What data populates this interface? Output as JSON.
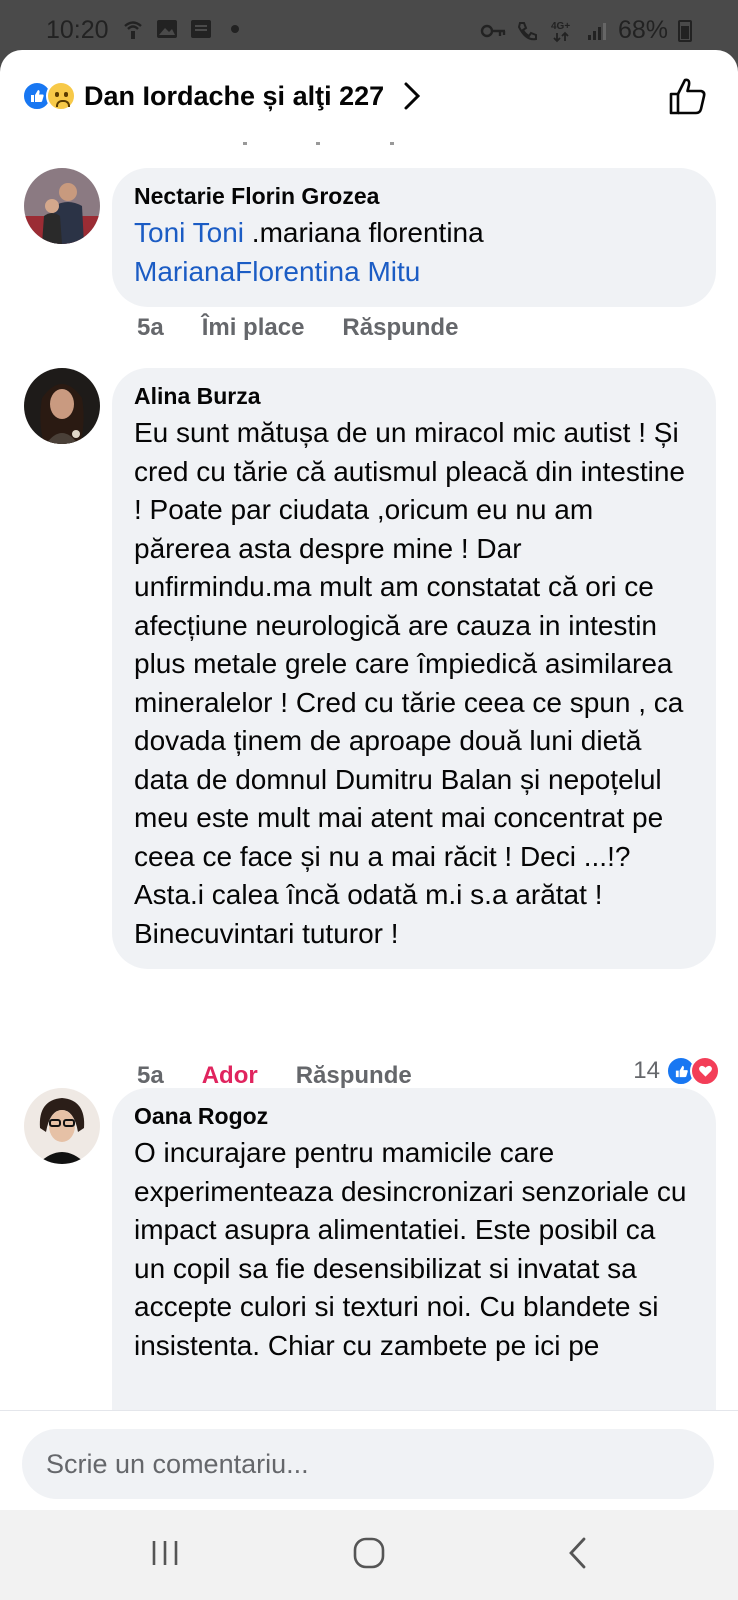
{
  "status_bar": {
    "time": "10:20",
    "battery": "68%"
  },
  "header": {
    "title": "Dan Iordache și alţi 227"
  },
  "comments": [
    {
      "author": "Nectarie Florin Grozea",
      "mention1": "Toni Toni",
      "text_mid": " .mariana florentina",
      "mention2": "MarianaFlorentina Mitu",
      "time": "5a",
      "like_label": "Îmi place",
      "reply_label": "Răspunde"
    },
    {
      "author": "Alina Burza",
      "text": "Eu sunt mătușa de un miracol mic autist ! Și cred cu tărie că autismul pleacă din intestine ! Poate par ciudata ,oricum eu nu am părerea asta despre mine ! Dar unfirmindu.ma mult am constatat că ori ce afecțiune neurologică are cauza in intestin plus metale grele care împiedică asimilarea mineralelor ! Cred cu tărie ceea ce spun , ca dovada ținem de aproape două luni dietă data de domnul Dumitru Balan și nepoțelul meu este mult mai atent mai concentrat pe ceea ce face și nu a mai răcit ! Deci ...!? Asta.i calea încă odată m.i s.a arătat ! Binecuvintari tuturor !",
      "time": "5a",
      "like_label": "Ador",
      "reply_label": "Răspunde",
      "reaction_count": "14"
    },
    {
      "author": "Oana Rogoz",
      "text": "O incurajare pentru mamicile care experimenteaza desincronizari senzoriale cu impact asupra alimentatiei. Este posibil ca un copil sa fie desensibilizat si invatat sa accepte culori si texturi noi. Cu blandete si insistenta. Chiar cu zambete pe ici pe"
    }
  ],
  "input": {
    "placeholder": "Scrie un comentariu..."
  },
  "colors": {
    "accent_blue": "#1877f2",
    "mention": "#1b5cc4",
    "love": "#e0245e",
    "bubble": "#f0f2f5"
  }
}
